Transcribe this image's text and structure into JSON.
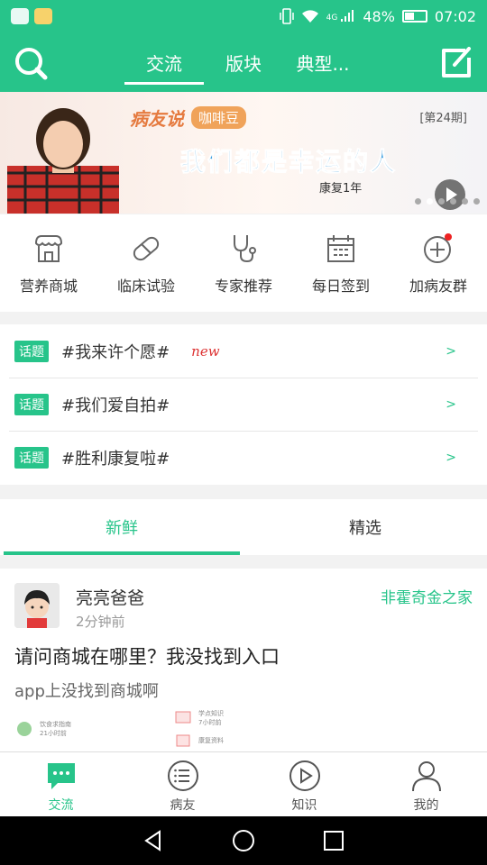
{
  "status_bar": {
    "signal_label": "4G",
    "battery": "48%",
    "time": "07:02",
    "battery_level": 0.48
  },
  "app_bar": {
    "tabs": [
      {
        "label": "交流",
        "active": true
      },
      {
        "label": "版块",
        "active": false
      },
      {
        "label": "典型...",
        "active": false
      }
    ],
    "search_icon": "search-icon",
    "compose_icon": "edit-icon"
  },
  "banner": {
    "brand": "病友说",
    "tag": "咖啡豆",
    "issue": "[第24期]",
    "headline": "我们都是幸运的人",
    "subtitle": "康复1年"
  },
  "quick_links": [
    {
      "label": "营养商城",
      "icon": "shop-icon"
    },
    {
      "label": "临床试验",
      "icon": "pill-icon"
    },
    {
      "label": "专家推荐",
      "icon": "stethoscope-icon"
    },
    {
      "label": "每日签到",
      "icon": "calendar-icon"
    },
    {
      "label": "加病友群",
      "icon": "add-group-icon"
    }
  ],
  "topics": [
    {
      "tag": "话题",
      "text": "#我来许个愿#",
      "badge": "new",
      "chevron": ">"
    },
    {
      "tag": "话题",
      "text": "#我们爱自拍#",
      "badge": "",
      "chevron": ">"
    },
    {
      "tag": "话题",
      "text": "#胜利康复啦#",
      "badge": "",
      "chevron": ">"
    }
  ],
  "segments": [
    {
      "label": "新鲜",
      "active": true
    },
    {
      "label": "精选",
      "active": false
    }
  ],
  "post": {
    "author": "亮亮爸爸",
    "time": "2分钟前",
    "group": "非霍奇金之家",
    "title": "请问商城在哪里？我没找到入口",
    "body": "app上没找到商城啊",
    "thumb_1": "饮食求指南",
    "thumb_1_sub": "21小时前",
    "thumb_2": "学点知识",
    "thumb_2_sub": "7小时前",
    "thumb_3": "康复资料"
  },
  "bottom_nav": [
    {
      "label": "交流",
      "icon": "chat-icon",
      "active": true
    },
    {
      "label": "病友",
      "icon": "list-icon",
      "active": false
    },
    {
      "label": "知识",
      "icon": "play-icon",
      "active": false
    },
    {
      "label": "我的",
      "icon": "person-icon",
      "active": false
    }
  ],
  "colors": {
    "accent": "#27c48a",
    "new_badge": "#dd3333",
    "banner_title": "#3fa0e0"
  }
}
